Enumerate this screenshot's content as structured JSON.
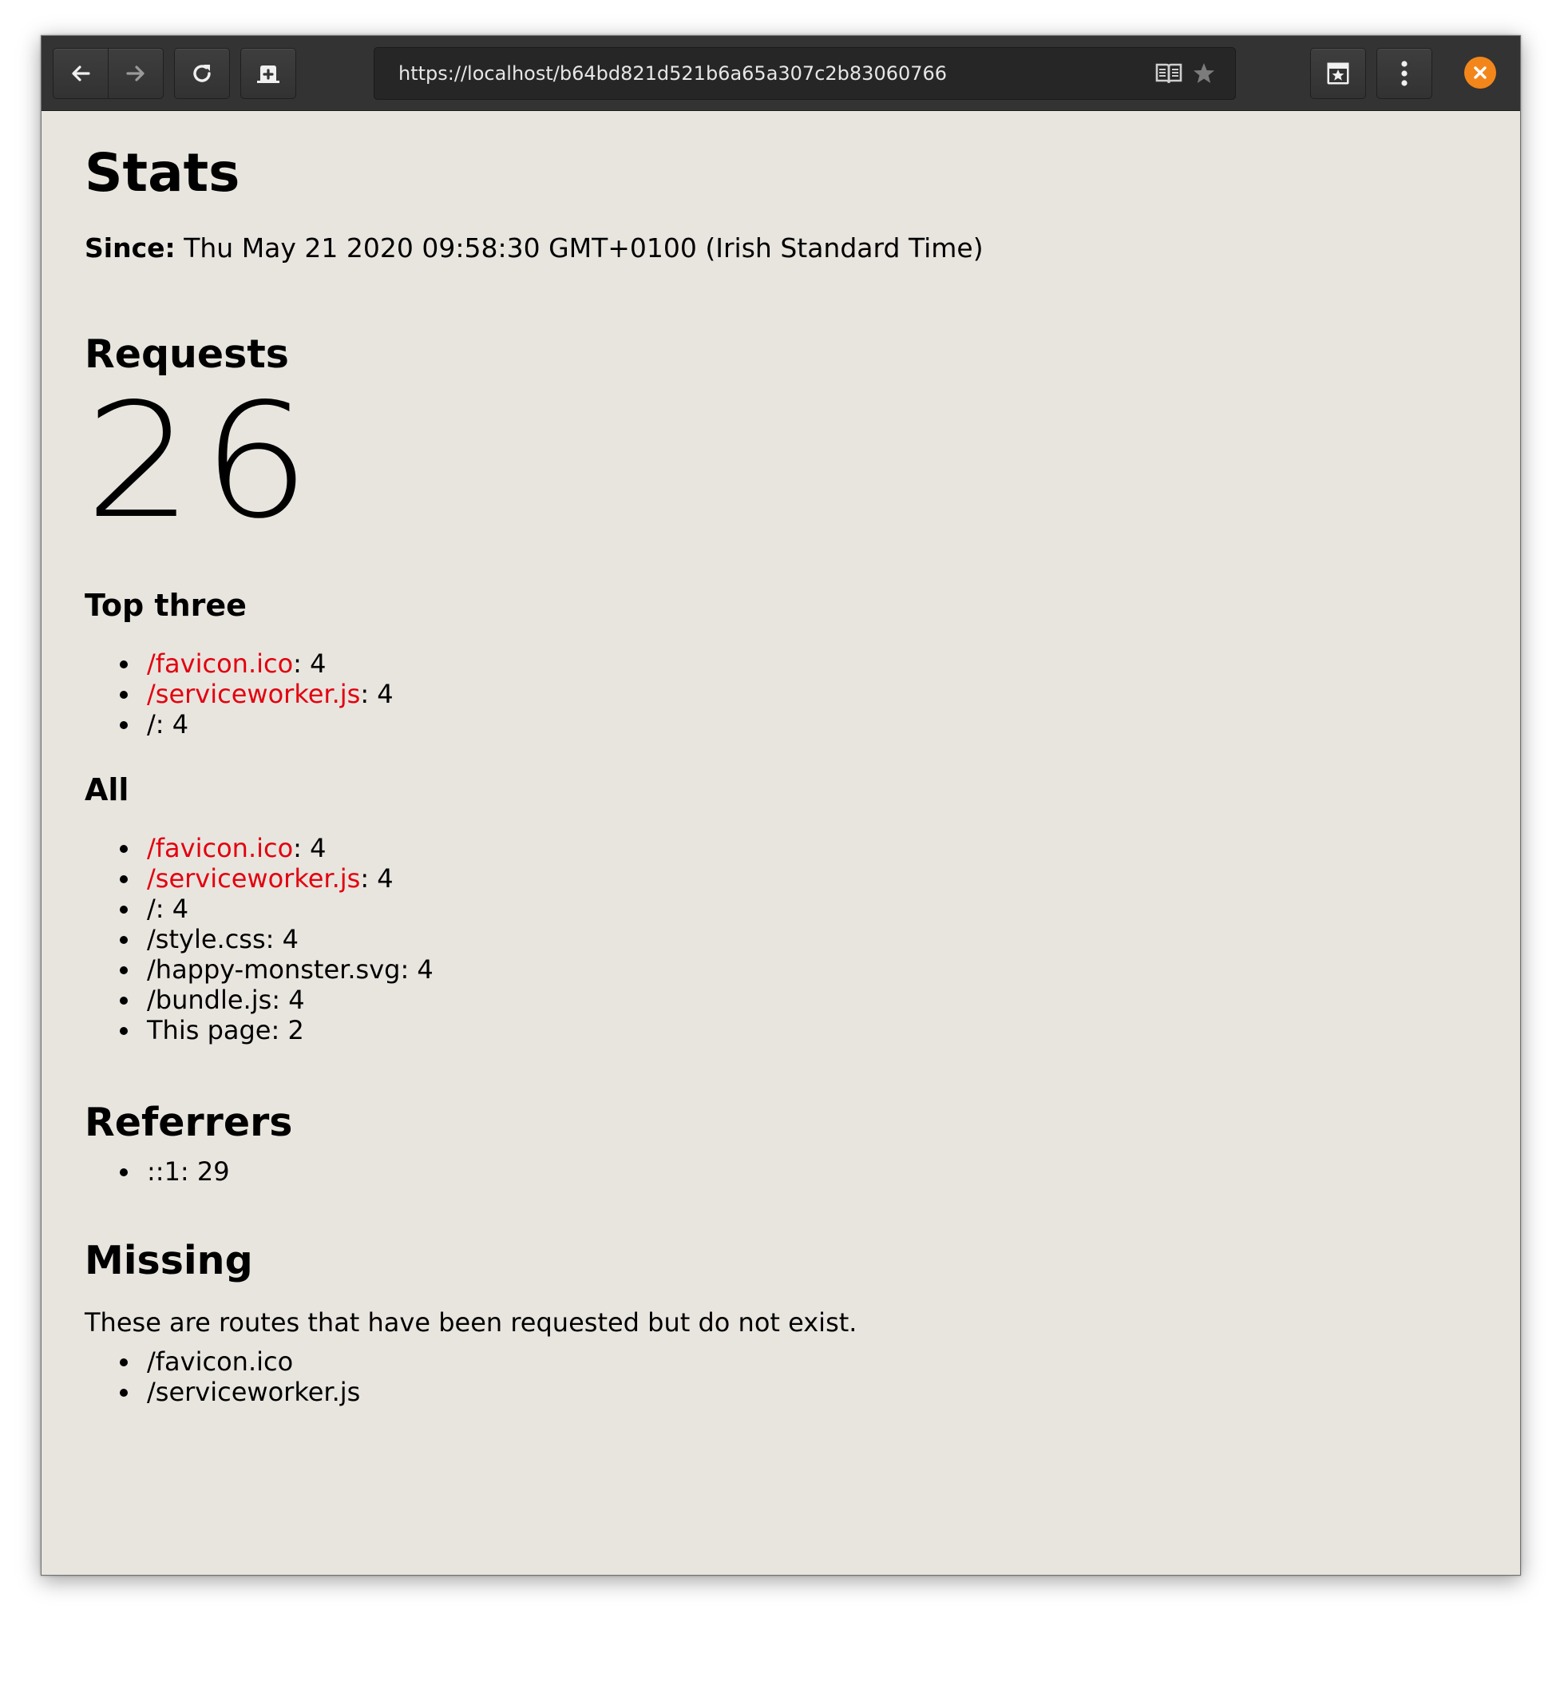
{
  "browser": {
    "url": "https://localhost/b64bd821d521b6a65a307c2b83060766",
    "accent_color": "#f3861b"
  },
  "page": {
    "title": "Stats",
    "since_label": "Since:",
    "since_value": "Thu May 21 2020 09:58:30 GMT+0100 (Irish Standard Time)",
    "requests_heading": "Requests",
    "requests_count": "26",
    "top_three_heading": "Top three",
    "top_three": [
      {
        "path": "/favicon.ico",
        "count": ": 4",
        "link": true
      },
      {
        "path": "/serviceworker.js",
        "count": ": 4",
        "link": true
      },
      {
        "path": "/",
        "count": ": 4",
        "link": false
      }
    ],
    "all_heading": "All",
    "all": [
      {
        "path": "/favicon.ico",
        "count": ": 4",
        "link": true
      },
      {
        "path": "/serviceworker.js",
        "count": ": 4",
        "link": true
      },
      {
        "path": "/",
        "count": ": 4",
        "link": false
      },
      {
        "path": "/style.css",
        "count": ": 4",
        "link": false
      },
      {
        "path": "/happy-monster.svg",
        "count": ": 4",
        "link": false
      },
      {
        "path": "/bundle.js",
        "count": ": 4",
        "link": false
      },
      {
        "path": "This page",
        "count": ": 2",
        "link": false
      }
    ],
    "referrers_heading": "Referrers",
    "referrers": [
      {
        "source": "::1",
        "count": ": 29"
      }
    ],
    "missing_heading": "Missing",
    "missing_description": "These are routes that have been requested but do not exist.",
    "missing": [
      "/favicon.ico",
      "/serviceworker.js"
    ],
    "link_color": "#e3000f"
  }
}
